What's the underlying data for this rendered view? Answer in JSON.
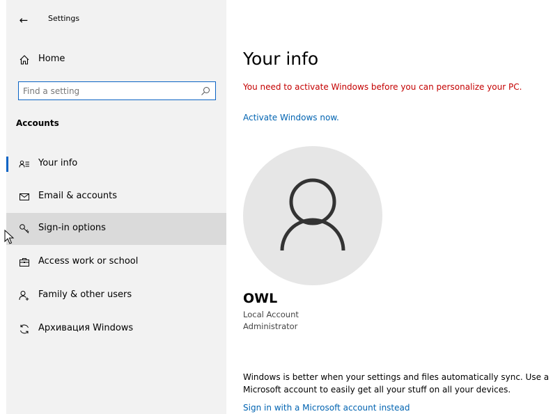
{
  "titlebar": {
    "back_label": "←",
    "title": "Settings"
  },
  "sidebar": {
    "home": {
      "label": "Home",
      "icon": "home-icon"
    },
    "search": {
      "placeholder": "Find a setting",
      "value": "",
      "icon": "search-icon"
    },
    "section_title": "Accounts",
    "items": [
      {
        "label": "Your info",
        "icon": "person-card-icon",
        "selected": true
      },
      {
        "label": "Email & accounts",
        "icon": "mail-icon",
        "selected": false
      },
      {
        "label": "Sign-in options",
        "icon": "key-icon",
        "selected": false,
        "hovered": true
      },
      {
        "label": "Access work or school",
        "icon": "briefcase-icon",
        "selected": false
      },
      {
        "label": "Family & other users",
        "icon": "add-person-icon",
        "selected": false
      },
      {
        "label": "Архивация Windows",
        "icon": "sync-icon",
        "selected": false
      }
    ]
  },
  "main": {
    "title": "Your info",
    "warning": "You need to activate Windows before you can personalize your PC.",
    "activate_link": "Activate Windows now.",
    "avatar_icon": "user-avatar-icon",
    "user": {
      "name": "OWL",
      "account_type": "Local Account",
      "role": "Administrator"
    },
    "sync_text": "Windows is better when your settings and files automatically sync. Use a Microsoft account to easily get all your stuff on all your devices.",
    "ms_link": "Sign in with a Microsoft account instead"
  },
  "colors": {
    "accent": "#0063b1",
    "warning": "#c40000",
    "sidebar_bg": "#f2f2f2",
    "hover_bg": "#dadada"
  }
}
